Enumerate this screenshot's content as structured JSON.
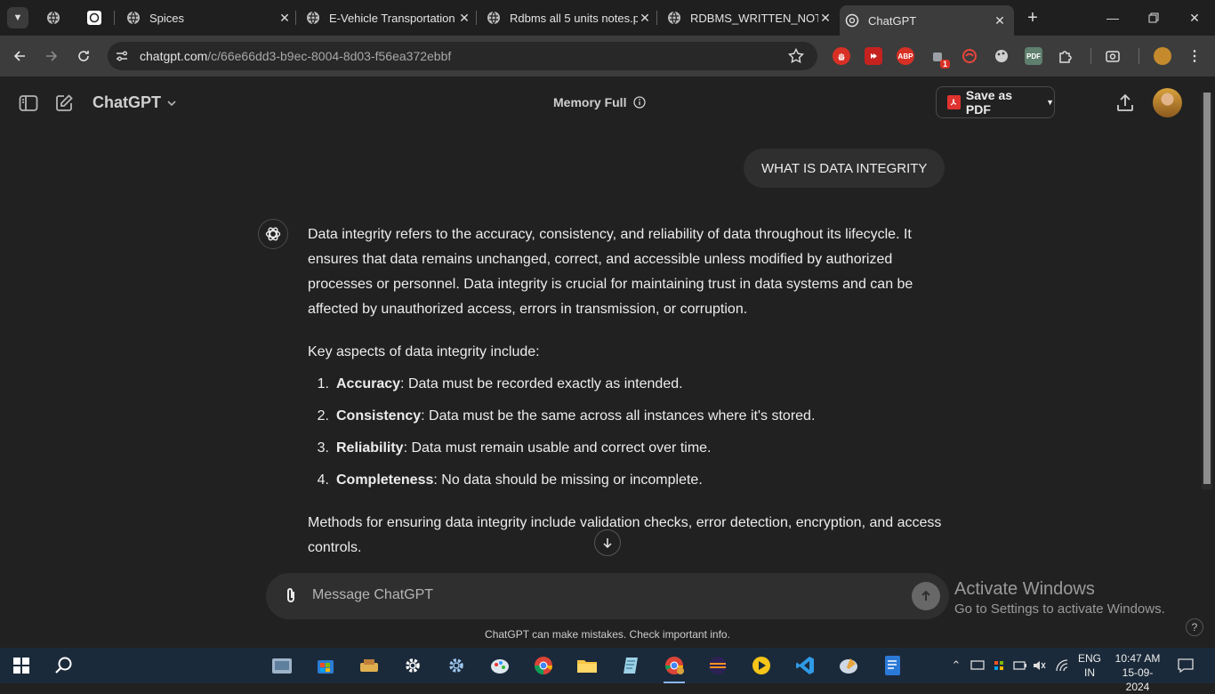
{
  "browser": {
    "tabs": [
      {
        "label": "Spices",
        "icon": "globe-icon",
        "active": false
      },
      {
        "label": "E-Vehicle Transportation",
        "icon": "globe-icon",
        "active": false
      },
      {
        "label": "Rdbms all 5 units notes.p",
        "icon": "globe-icon",
        "active": false
      },
      {
        "label": "RDBMS_WRITTEN_NOTES",
        "icon": "globe-icon",
        "active": false
      },
      {
        "label": "ChatGPT",
        "icon": "openai-icon",
        "active": true
      }
    ],
    "url_host": "chatgpt.com",
    "url_path": "/c/66e66dd3-b9ec-8004-8d03-f56ea372ebbf",
    "extension_badge": "1",
    "abp_label": "ABP",
    "pdf_ext_label": "PDF"
  },
  "header": {
    "app_title": "ChatGPT",
    "memory_label": "Memory Full",
    "save_pdf_label": "Save as PDF"
  },
  "conversation": {
    "user_message": "WHAT IS DATA INTEGRITY",
    "answer_intro": "Data integrity refers to the accuracy, consistency, and reliability of data throughout its lifecycle. It ensures that data remains unchanged, correct, and accessible unless modified by authorized processes or personnel. Data integrity is crucial for maintaining trust in data systems and can be affected by unauthorized access, errors in transmission, or corruption.",
    "aspects_heading": "Key aspects of data integrity include:",
    "aspects": [
      {
        "num": "1.",
        "term": "Accuracy",
        "desc": ": Data must be recorded exactly as intended."
      },
      {
        "num": "2.",
        "term": "Consistency",
        "desc": ": Data must be the same across all instances where it's stored."
      },
      {
        "num": "3.",
        "term": "Reliability",
        "desc": ": Data must remain usable and correct over time."
      },
      {
        "num": "4.",
        "term": "Completeness",
        "desc": ": No data should be missing or incomplete."
      }
    ],
    "answer_outro": "Methods for ensuring data integrity include validation checks, error detection, encryption, and access controls."
  },
  "composer": {
    "placeholder": "Message ChatGPT",
    "disclaimer": "ChatGPT can make mistakes. Check important info."
  },
  "watermark": {
    "line1": "Activate Windows",
    "line2": "Go to Settings to activate Windows."
  },
  "help_label": "?",
  "taskbar": {
    "lang_line1": "ENG",
    "lang_line2": "IN",
    "time": "10:47 AM",
    "date": "15-09-2024"
  }
}
